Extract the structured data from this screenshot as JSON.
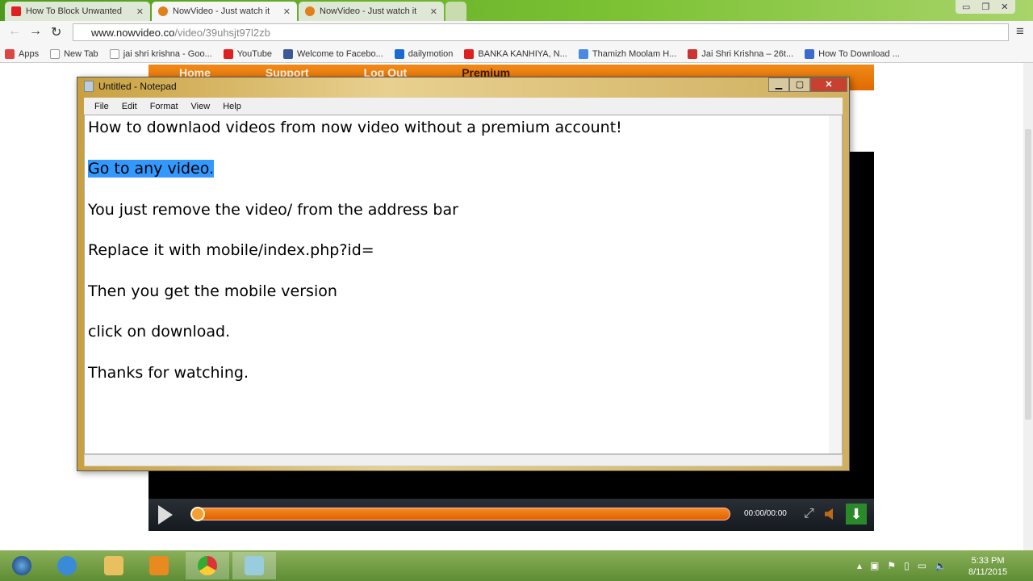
{
  "browser": {
    "tabs": [
      {
        "title": "How To Block Unwanted",
        "icon": "youtube-icon"
      },
      {
        "title": "NowVideo - Just watch it",
        "icon": "nowvideo-icon",
        "active": true
      },
      {
        "title": "NowVideo - Just watch it",
        "icon": "nowvideo-icon"
      }
    ],
    "url_host": "www.nowvideo.co",
    "url_path": "/video/39uhsjt97l2zb",
    "bookmarks": [
      "Apps",
      "New Tab",
      "jai shri krishna - Goo...",
      "YouTube",
      "Welcome to Facebo...",
      "dailymotion",
      "BANKA KANHIYA, N...",
      "Thamizh Moolam H...",
      "Jai Shri Krishna – 26t...",
      "How To Download ..."
    ]
  },
  "site": {
    "nav": [
      "Home",
      "Support",
      "Log Out",
      "Premium"
    ],
    "player": {
      "time": "00:00/00:00",
      "progress": 0
    }
  },
  "notepad": {
    "title": "Untitled - Notepad",
    "menu": [
      "File",
      "Edit",
      "Format",
      "View",
      "Help"
    ],
    "lines": [
      "How to downlaod videos from now video without a premium account!",
      "Go to any video.",
      "You just remove the video/ from the address bar",
      "Replace it with mobile/index.php?id=",
      "Then you get the mobile version",
      "click on download.",
      "Thanks for watching."
    ],
    "selected_line": 1
  },
  "taskbar": {
    "time": "5:33 PM",
    "date": "8/11/2015"
  }
}
